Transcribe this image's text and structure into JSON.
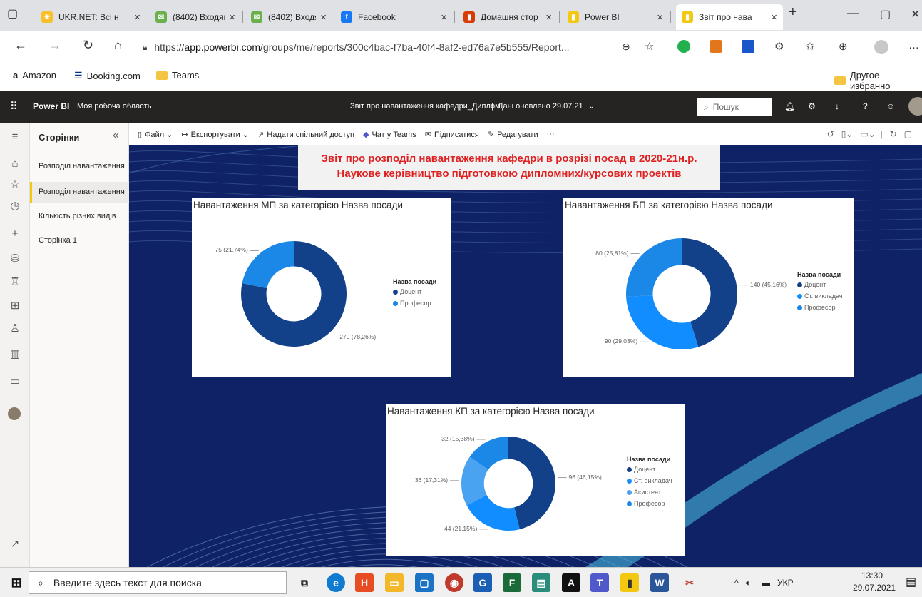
{
  "browser": {
    "tabs": [
      {
        "title": "UKR.NET: Всі н",
        "color": "#f9c02d",
        "glyph": "✷"
      },
      {
        "title": "(8402) Входящ",
        "color": "#6ab04c",
        "glyph": "✉"
      },
      {
        "title": "(8402) Входящ",
        "color": "#6ab04c",
        "glyph": "✉"
      },
      {
        "title": "Facebook",
        "color": "#1877f2",
        "glyph": "f"
      },
      {
        "title": "Домашня стор",
        "color": "#d83b01",
        "glyph": "▮"
      },
      {
        "title": "Power BI",
        "color": "#f2c811",
        "glyph": "▮"
      },
      {
        "title": "Звіт про нава",
        "color": "#f2c811",
        "glyph": "▮"
      }
    ],
    "url_scheme": "https://",
    "url_host": "app.powerbi.com",
    "url_path": "/groups/me/reports/300c4bac-f7ba-40f4-8af2-ed76a7e5b555/Report...",
    "favorites": [
      "Amazon",
      "Booking.com",
      "Teams"
    ],
    "other_favorites": "Другое избранно"
  },
  "pbi": {
    "brand": "Power BI",
    "workspace": "Моя робоча область",
    "report_title": "Звіт про навантаження кафедри_Диплом...",
    "updated": "Дані оновлено 29.07.21",
    "search_placeholder": "Пошук",
    "pages_title": "Сторінки",
    "pages": [
      "Розподіл навантаження",
      "Розподіл навантаження",
      "Кількість різних видів",
      "Сторінка 1"
    ],
    "actions": {
      "file": "Файл",
      "export": "Експортувати",
      "share": "Надати спільний доступ",
      "teams": "Чат у Teams",
      "subscribe": "Підписатися",
      "edit": "Редагувати",
      "more": "···"
    }
  },
  "report": {
    "banner_line1": "Звіт про розподіл навантаження  кафедри в розрізі посад в 2020-21н.р.",
    "banner_line2": "Наукове керівництво  підготовкою дипломних/курсових проектів"
  },
  "colors": {
    "docent": "#12418a",
    "senior_lecturer": "#118dff",
    "assistant": "#4aa3f0",
    "professor": "#1b87e6"
  },
  "chart_data": [
    {
      "type": "pie",
      "title": "Навантаження МП за категорією Назва посади",
      "legend_title": "Назва посади",
      "categories": [
        "Доцент",
        "Професор"
      ],
      "values": [
        270,
        75
      ],
      "labels": [
        "270 (78,26%)",
        "75 (21,74%)"
      ]
    },
    {
      "type": "pie",
      "title": "Навантаження БП за категорією Назва посади",
      "legend_title": "Назва посади",
      "categories": [
        "Доцент",
        "Ст. викладач",
        "Професор"
      ],
      "values": [
        140,
        90,
        80
      ],
      "labels": [
        "140 (45,16%)",
        "90 (29,03%)",
        "80 (25,81%)"
      ]
    },
    {
      "type": "pie",
      "title": "Навантаження КП за категорією Назва посади",
      "legend_title": "Назва посади",
      "categories": [
        "Доцент",
        "Ст. викладач",
        "Асистент",
        "Професор"
      ],
      "values": [
        96,
        44,
        36,
        32
      ],
      "labels": [
        "96 (46,15%)",
        "44 (21,15%)",
        "36 (17,31%)",
        "32 (15,38%)"
      ]
    }
  ],
  "taskbar": {
    "search_placeholder": "Введите здесь текст для поиска",
    "lang": "УКР",
    "time": "13:30",
    "date": "29.07.2021"
  }
}
